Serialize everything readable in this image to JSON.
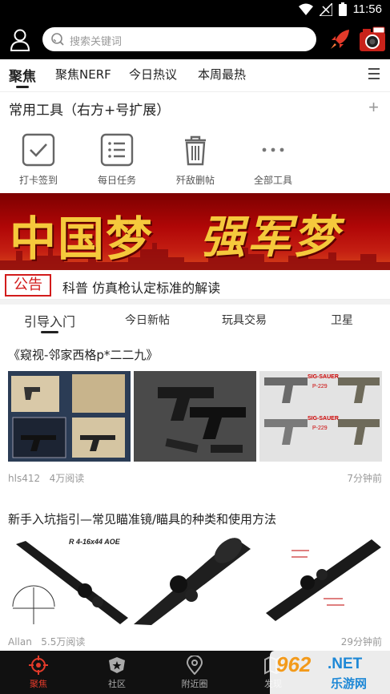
{
  "status_bar": {
    "time": "11:56"
  },
  "search": {
    "placeholder": "搜索关键词"
  },
  "channel_tabs": [
    {
      "label": "聚焦",
      "active": true
    },
    {
      "label": "聚焦NERF"
    },
    {
      "label": "今日热议"
    },
    {
      "label": "本周最热"
    }
  ],
  "tools": {
    "title": "常用工具（右方+号扩展）",
    "plus": "+",
    "items": [
      {
        "label": "打卡签到",
        "icon": "checkbox-icon"
      },
      {
        "label": "每日任务",
        "icon": "list-icon"
      },
      {
        "label": "歼敌删帖",
        "icon": "trash-icon"
      },
      {
        "label": "全部工具",
        "icon": "more-dots-icon"
      }
    ]
  },
  "banner": {
    "text_1": "中国梦",
    "text_2": "强军梦"
  },
  "notice": {
    "badge": "公告",
    "text": "科普 仿真枪认定标准的解读"
  },
  "sub_tabs": [
    {
      "label": "引导入门",
      "active": true
    },
    {
      "label": "今日新帖"
    },
    {
      "label": "玩具交易"
    },
    {
      "label": "卫星"
    }
  ],
  "articles": [
    {
      "title": "《窥视-邻家西格p*二二九》",
      "author": "hls412",
      "reads": "4万阅读",
      "time": "7分钟前",
      "thumb_texts": [
        "SIG-SAUER",
        "P-229",
        "SIG-SAUER",
        "P-229"
      ]
    },
    {
      "title": "新手入坑指引—常见瞄准镜/瞄具的种类和使用方法",
      "author": "Allan",
      "reads": "5.5万阅读",
      "time": "29分钟前",
      "thumb_texts": [
        "R 4-16x44 AOE"
      ]
    }
  ],
  "bottom_nav": [
    {
      "label": "聚焦",
      "icon": "target-icon",
      "active": true
    },
    {
      "label": "社区",
      "icon": "community-icon"
    },
    {
      "label": "附近圈",
      "icon": "location-icon"
    },
    {
      "label": "发现",
      "icon": "map-icon"
    }
  ],
  "watermark": {
    "text_1": "962",
    "text_2": ".NET",
    "text_3": "乐游网"
  },
  "colors": {
    "accent": "#e23a2a",
    "banner_gold": "#f5c93c",
    "notice_red": "#d21b1b"
  }
}
